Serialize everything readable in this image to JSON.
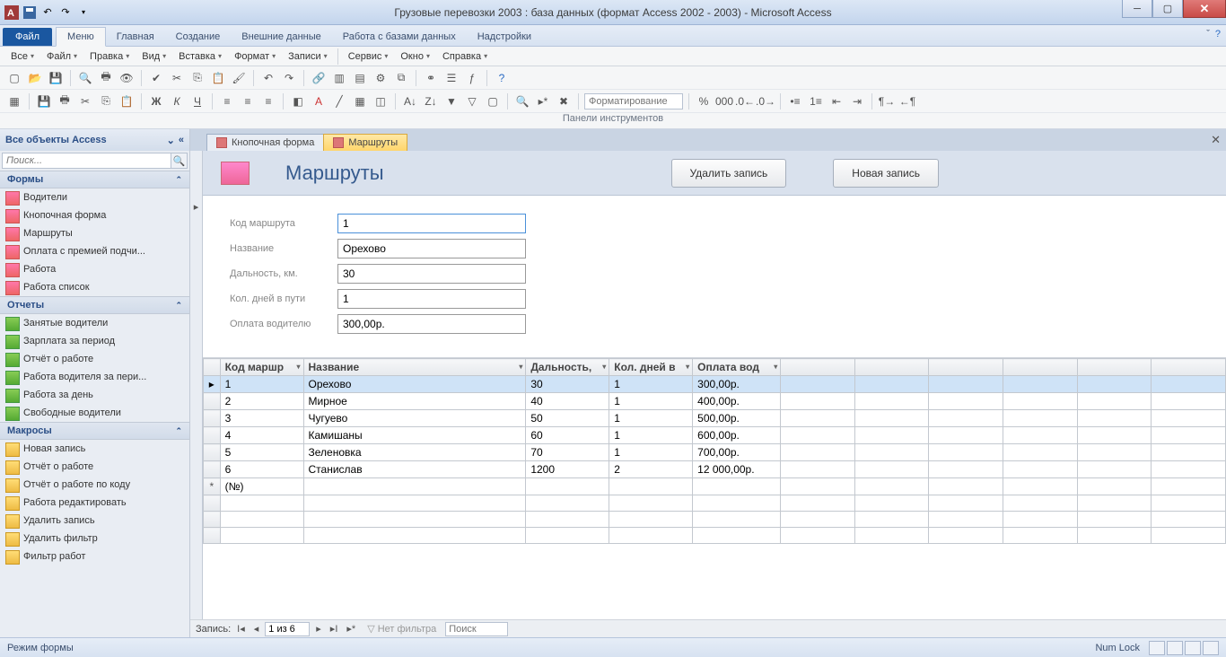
{
  "title": "Грузовые перевозки 2003 : база данных (формат Access 2002 - 2003)  -  Microsoft Access",
  "ribbon": {
    "file": "Файл",
    "tabs": [
      "Меню",
      "Главная",
      "Создание",
      "Внешние данные",
      "Работа с базами данных",
      "Надстройки"
    ],
    "activeTab": 0
  },
  "menubar": [
    "Все",
    "Файл",
    "Правка",
    "Вид",
    "Вставка",
    "Формат",
    "Записи",
    "Сервис",
    "Окно",
    "Справка"
  ],
  "toolcaption": "Панели инструментов",
  "formatting_placeholder": "Форматирование",
  "nav": {
    "title": "Все объекты Access",
    "search_placeholder": "Поиск...",
    "groups": [
      {
        "name": "Формы",
        "type": "form",
        "items": [
          "Водители",
          "Кнопочная форма",
          "Маршруты",
          "Оплата с премией подчи...",
          "Работа",
          "Работа список"
        ]
      },
      {
        "name": "Отчеты",
        "type": "report",
        "items": [
          "Занятые водители",
          "Зарплата за период",
          "Отчёт о работе",
          "Работа водителя за пери...",
          "Работа за день",
          "Свободные водители"
        ]
      },
      {
        "name": "Макросы",
        "type": "macro",
        "items": [
          "Новая запись",
          "Отчёт о работе",
          "Отчёт о работе по коду",
          "Работа редактировать",
          "Удалить запись",
          "Удалить фильтр",
          "Фильтр работ"
        ]
      }
    ]
  },
  "docTabs": [
    {
      "label": "Кнопочная форма",
      "active": false
    },
    {
      "label": "Маршруты",
      "active": true
    }
  ],
  "form": {
    "title": "Маршруты",
    "buttons": {
      "delete": "Удалить запись",
      "new": "Новая запись"
    },
    "fields": [
      {
        "label": "Код маршрута",
        "value": "1"
      },
      {
        "label": "Название",
        "value": "Орехово"
      },
      {
        "label": "Дальность, км.",
        "value": "30"
      },
      {
        "label": "Кол. дней в пути",
        "value": "1"
      },
      {
        "label": "Оплата водителю",
        "value": "300,00р."
      }
    ]
  },
  "grid": {
    "columns": [
      "Код маршр",
      "Название",
      "Дальность,",
      "Кол. дней в",
      "Оплата вод"
    ],
    "rows": [
      [
        "1",
        "Орехово",
        "30",
        "1",
        "300,00р."
      ],
      [
        "2",
        "Мирное",
        "40",
        "1",
        "400,00р."
      ],
      [
        "3",
        "Чугуево",
        "50",
        "1",
        "500,00р."
      ],
      [
        "4",
        "Камишаны",
        "60",
        "1",
        "600,00р."
      ],
      [
        "5",
        "Зеленовка",
        "70",
        "1",
        "700,00р."
      ],
      [
        "6",
        "Станислав",
        "1200",
        "2",
        "12 000,00р."
      ]
    ],
    "newrow": "(№)"
  },
  "recnav": {
    "label": "Запись:",
    "pos": "1 из 6",
    "nofilter": "Нет фильтра",
    "search": "Поиск"
  },
  "status": {
    "left": "Режим формы",
    "right": "Num Lock"
  }
}
